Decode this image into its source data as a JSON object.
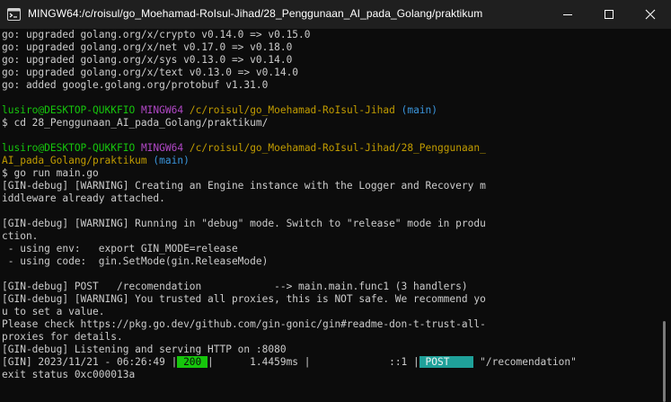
{
  "window": {
    "title": "MINGW64:/c/roisul/go_Moehamad-RoIsul-Jihad/28_Penggunaan_AI_pada_Golang/praktikum"
  },
  "icons": {
    "app": "git-bash-terminal-icon",
    "minimize": "minimize-icon",
    "maximize": "maximize-icon",
    "close": "close-icon"
  },
  "colors": {
    "background": "#0c0c0c",
    "text": "#cccccc",
    "user_host": "#16c60c",
    "mingw": "#b148c6",
    "path": "#c19c00",
    "branch": "#3a96dd",
    "status_200": "#16c60c",
    "method_post": "#1fa19a"
  },
  "terminal": {
    "upgrade_lines": [
      "go: upgraded golang.org/x/crypto v0.14.0 => v0.15.0",
      "go: upgraded golang.org/x/net v0.17.0 => v0.18.0",
      "go: upgraded golang.org/x/sys v0.13.0 => v0.14.0",
      "go: upgraded golang.org/x/text v0.13.0 => v0.14.0",
      "go: added google.golang.org/protobuf v1.31.0"
    ],
    "prompt1": {
      "user_host": "lusiro@DESKTOP-QUKKFIO",
      "mingw": "MINGW64",
      "path": "/c/roisul/go_Moehamad-RoIsul-Jihad",
      "branch": "(main)",
      "command": "$ cd 28_Penggunaan_AI_pada_Golang/praktikum/"
    },
    "prompt2": {
      "user_host": "lusiro@DESKTOP-QUKKFIO",
      "mingw": "MINGW64",
      "path_line1": "/c/roisul/go_Moehamad-RoIsul-Jihad/28_Penggunaan_",
      "path_line2": "AI_pada_Golang/praktikum",
      "branch": "(main)",
      "command": "$ go run main.go"
    },
    "output_lines": [
      "[GIN-debug] [WARNING] Creating an Engine instance with the Logger and Recovery m",
      "iddleware already attached.",
      "",
      "[GIN-debug] [WARNING] Running in \"debug\" mode. Switch to \"release\" mode in produ",
      "ction.",
      " - using env:   export GIN_MODE=release",
      " - using code:  gin.SetMode(gin.ReleaseMode)",
      "",
      "[GIN-debug] POST   /recomendation            --> main.main.func1 (3 handlers)",
      "[GIN-debug] [WARNING] You trusted all proxies, this is NOT safe. We recommend yo",
      "u to set a value.",
      "Please check https://pkg.go.dev/github.com/gin-gonic/gin#readme-don-t-trust-all-",
      "proxies for details.",
      "[GIN-debug] Listening and serving HTTP on :8080"
    ],
    "request_log": {
      "prefix": "[GIN] 2023/11/21 - 06:26:49 |",
      "status": " 200 ",
      "latency": "|      1.4459ms |             ::1 |",
      "method": " POST    ",
      "path": " \"/recomendation\""
    },
    "exit_line": "exit status 0xc000013a"
  }
}
